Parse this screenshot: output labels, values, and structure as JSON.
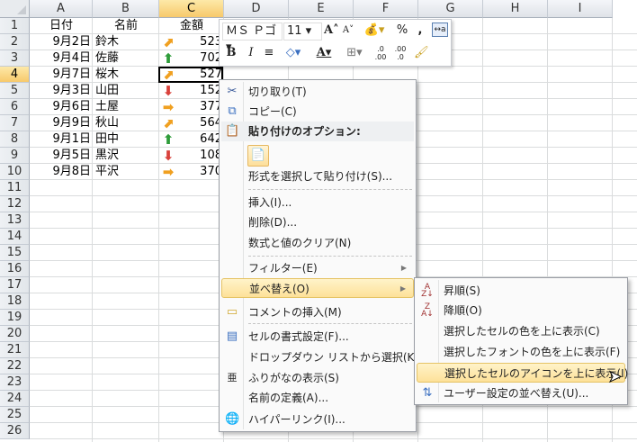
{
  "columns": [
    "A",
    "B",
    "C",
    "D",
    "E",
    "F",
    "G",
    "H",
    "I"
  ],
  "rows": [
    "1",
    "2",
    "3",
    "4",
    "5",
    "6",
    "7",
    "8",
    "9",
    "10",
    "11",
    "12",
    "13",
    "14",
    "15",
    "16",
    "17",
    "18",
    "19",
    "20",
    "21",
    "22",
    "23",
    "24",
    "25",
    "26"
  ],
  "headers": {
    "a": "日付",
    "b": "名前",
    "c": "金額"
  },
  "data": [
    {
      "date": "9月2日",
      "name": "鈴木",
      "icon": "arrow-up-right",
      "amount": "523"
    },
    {
      "date": "9月4日",
      "name": "佐藤",
      "icon": "arrow-up",
      "amount": "702"
    },
    {
      "date": "9月7日",
      "name": "桜木",
      "icon": "arrow-up-right",
      "amount": "527"
    },
    {
      "date": "9月3日",
      "name": "山田",
      "icon": "arrow-down",
      "amount": "152"
    },
    {
      "date": "9月6日",
      "name": "土屋",
      "icon": "arrow-right",
      "amount": "377"
    },
    {
      "date": "9月9日",
      "name": "秋山",
      "icon": "arrow-up-right",
      "amount": "564"
    },
    {
      "date": "9月1日",
      "name": "田中",
      "icon": "arrow-up",
      "amount": "642"
    },
    {
      "date": "9月5日",
      "name": "黒沢",
      "icon": "arrow-down",
      "amount": "108"
    },
    {
      "date": "9月8日",
      "name": "平沢",
      "icon": "arrow-right",
      "amount": "370"
    }
  ],
  "icon_colors": {
    "arrow-up": "#2e9c3a",
    "arrow-down": "#d9413b",
    "arrow-right": "#f0a020",
    "arrow-up-right": "#f0a020"
  },
  "mini_toolbar": {
    "font": "ＭＳ Ｐゴ",
    "size": "11",
    "percent": "%",
    "comma": ","
  },
  "menu": {
    "cut": "切り取り(T)",
    "copy": "コピー(C)",
    "paste_options": "貼り付けのオプション:",
    "paste_special": "形式を選択して貼り付け(S)...",
    "insert": "挿入(I)...",
    "delete": "削除(D)...",
    "clear": "数式と値のクリア(N)",
    "filter": "フィルター(E)",
    "sort": "並べ替え(O)",
    "comment": "コメントの挿入(M)",
    "format": "セルの書式設定(F)...",
    "dropdown": "ドロップダウン リストから選択(K)...",
    "furigana": "ふりがなの表示(S)",
    "define_name": "名前の定義(A)...",
    "hyperlink": "ハイパーリンク(I)..."
  },
  "submenu": {
    "asc": "昇順(S)",
    "desc": "降順(O)",
    "cell_color": "選択したセルの色を上に表示(C)",
    "font_color": "選択したフォントの色を上に表示(F)",
    "cell_icon": "選択したセルのアイコンを上に表示(I)",
    "custom": "ユーザー設定の並べ替え(U)..."
  }
}
